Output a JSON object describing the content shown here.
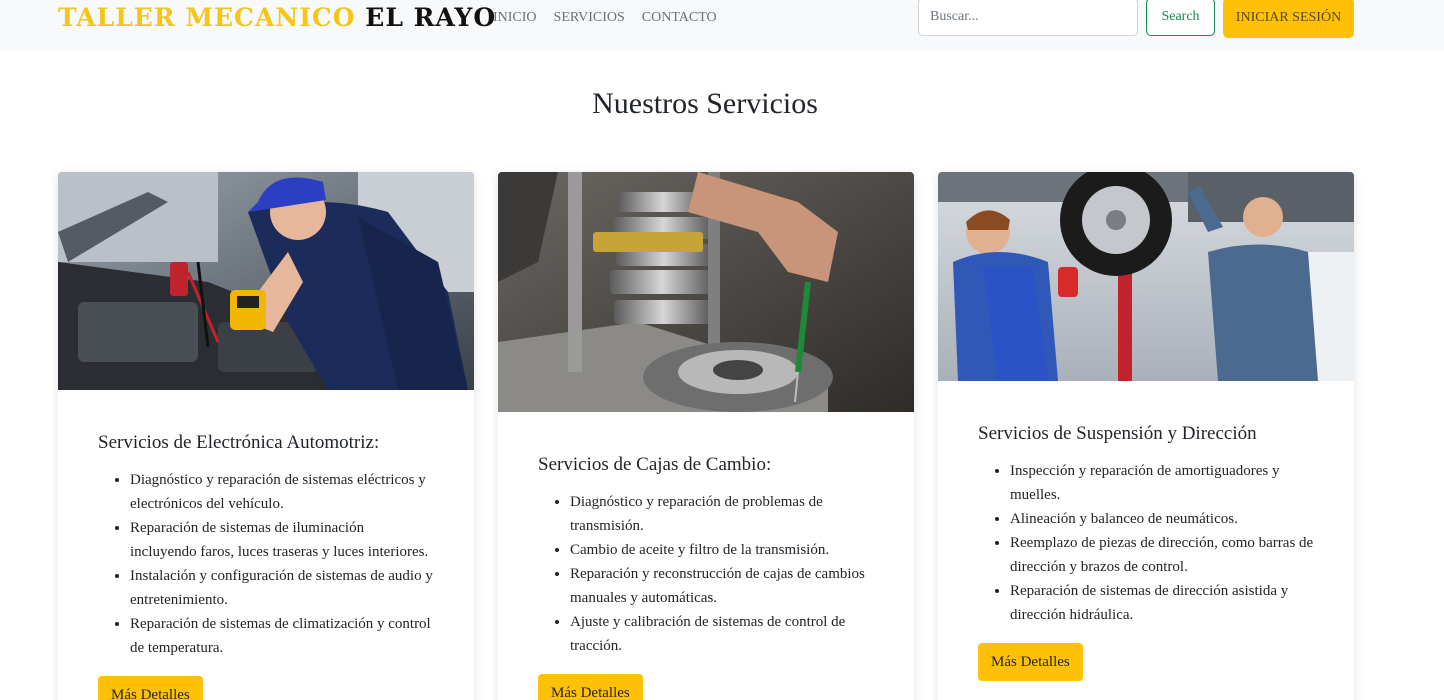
{
  "navbar": {
    "brand_part1": "TALLER MECANICO",
    "brand_part2": "EL RAYO",
    "links": [
      "INICIO",
      "SERVICIOS",
      "CONTACTO"
    ],
    "search_placeholder": "Buscar...",
    "search_button": "Search",
    "login_button": "INICIAR SESIÓN"
  },
  "page_title": "Nuestros Servicios",
  "cards": [
    {
      "image": "mechanic-with-multimeter-photo",
      "title": "Servicios de Electrónica Automotriz:",
      "items": [
        "Diagnóstico y reparación de sistemas eléctricos y electrónicos del vehículo.",
        "Reparación de sistemas de iluminación incluyendo faros, luces traseras y luces interiores.",
        "Instalación y configuración de sistemas de audio y entretenimiento.",
        "Reparación de sistemas de climatización y control de temperatura."
      ],
      "button": "Más Detalles"
    },
    {
      "image": "gearbox-repair-photo",
      "title": "Servicios de Cajas de Cambio:",
      "items": [
        "Diagnóstico y reparación de problemas de transmisión.",
        "Cambio de aceite y filtro de la transmisión.",
        "Reparación y reconstrucción de cajas de cambios manuales y automáticas.",
        "Ajuste y calibración de sistemas de control de tracción."
      ],
      "button": "Más Detalles"
    },
    {
      "image": "mechanics-under-lifted-car-photo",
      "title": "Servicios de Suspensión y Dirección",
      "items": [
        "Inspección y reparación de amortiguadores y muelles.",
        "Alineación y balanceo de neumáticos.",
        "Reemplazo de piezas de dirección, como barras de dirección y brazos de control.",
        "Reparación de sistemas de dirección asistida y dirección hidráulica."
      ],
      "button": "Más Detalles"
    }
  ],
  "colors": {
    "brand_yellow": "#f5c518",
    "button_yellow": "#ffc107",
    "search_green": "#198754",
    "navbar_bg": "#f8f9fa"
  }
}
